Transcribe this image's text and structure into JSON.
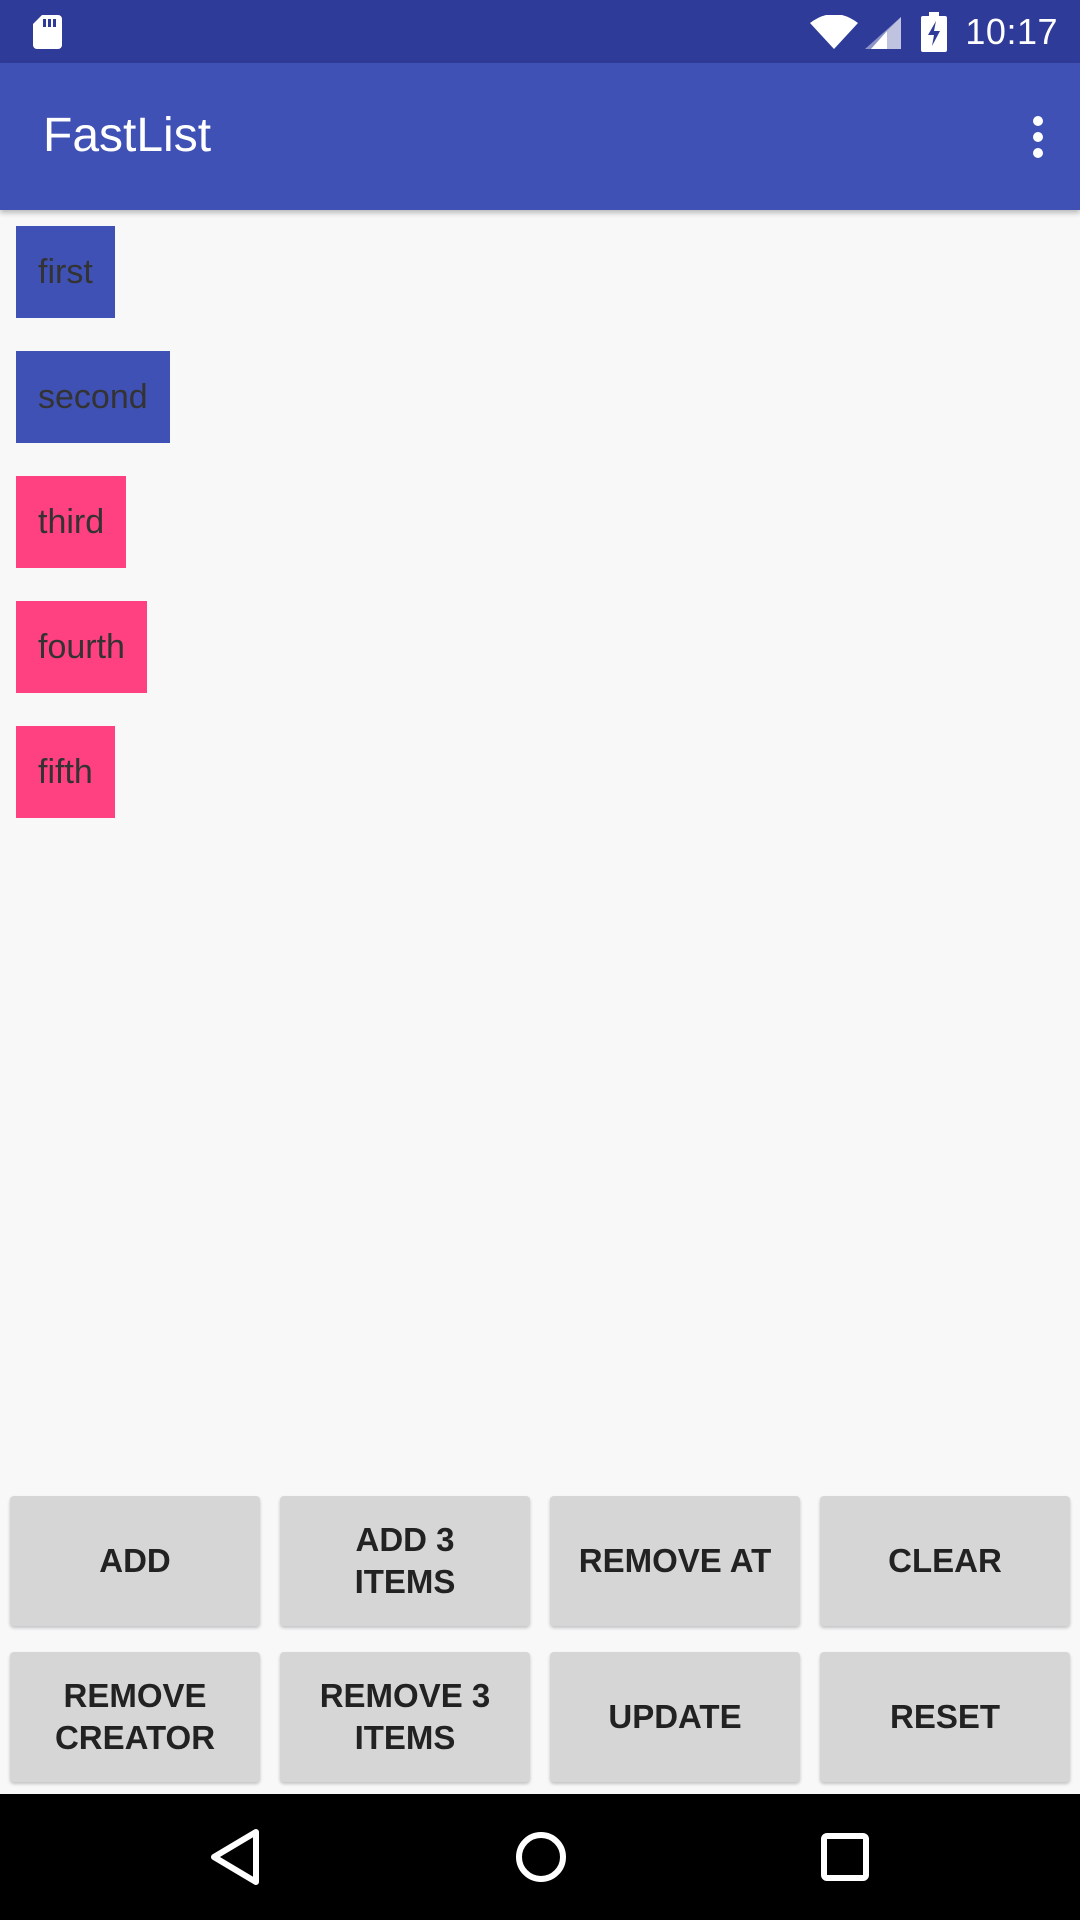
{
  "status_bar": {
    "time": "10:17",
    "icons": [
      "sd-card-icon",
      "wifi-icon",
      "cell-signal-icon",
      "battery-charging-icon"
    ]
  },
  "app_bar": {
    "title": "FastList",
    "menu_icon": "more-vert-icon"
  },
  "colors": {
    "status_bar": "#2f3b98",
    "app_bar": "#3f51b5",
    "primary": "#3f51b5",
    "accent": "#ff4081",
    "background": "#f8f8f9",
    "button": "#d6d6d7",
    "nav_bar": "#000000"
  },
  "list": {
    "items": [
      {
        "label": "first",
        "color": "primary"
      },
      {
        "label": "second",
        "color": "primary"
      },
      {
        "label": "third",
        "color": "accent"
      },
      {
        "label": "fourth",
        "color": "accent"
      },
      {
        "label": "fifth",
        "color": "accent"
      }
    ]
  },
  "buttons": {
    "add": "ADD",
    "add_3_items": "ADD 3\nITEMS",
    "remove_at": "REMOVE AT",
    "clear": "CLEAR",
    "remove_creator": "REMOVE\nCREATOR",
    "remove_3_items": "REMOVE 3\nITEMS",
    "update": "UPDATE",
    "reset": "RESET"
  },
  "nav_bar": {
    "icons": [
      "back-icon",
      "home-icon",
      "recents-icon"
    ]
  }
}
